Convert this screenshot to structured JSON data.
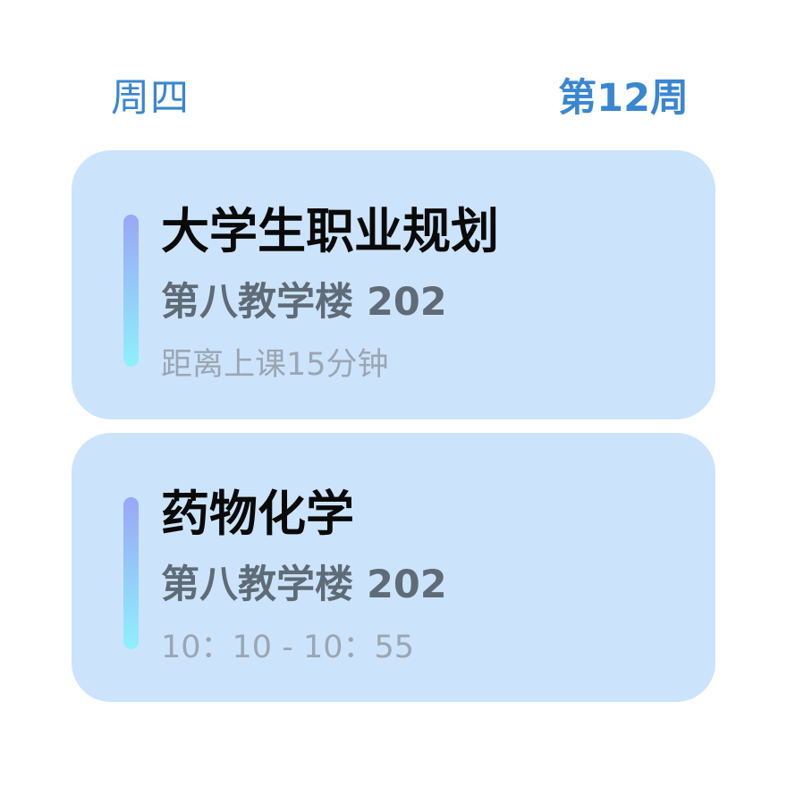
{
  "header": {
    "weekday": "周四",
    "week_number": "第12周"
  },
  "colors": {
    "accent_text": "#3a86d1",
    "card_background": "#cce4fb",
    "bar_gradient_top": "#9aa6f6",
    "bar_gradient_bottom": "#8ff0fb"
  },
  "courses": [
    {
      "name": "大学生职业规划",
      "location": "第八教学楼 202",
      "info": "距离上课15分钟"
    },
    {
      "name": "药物化学",
      "location": "第八教学楼 202",
      "info": "10：10 - 10：55"
    }
  ]
}
